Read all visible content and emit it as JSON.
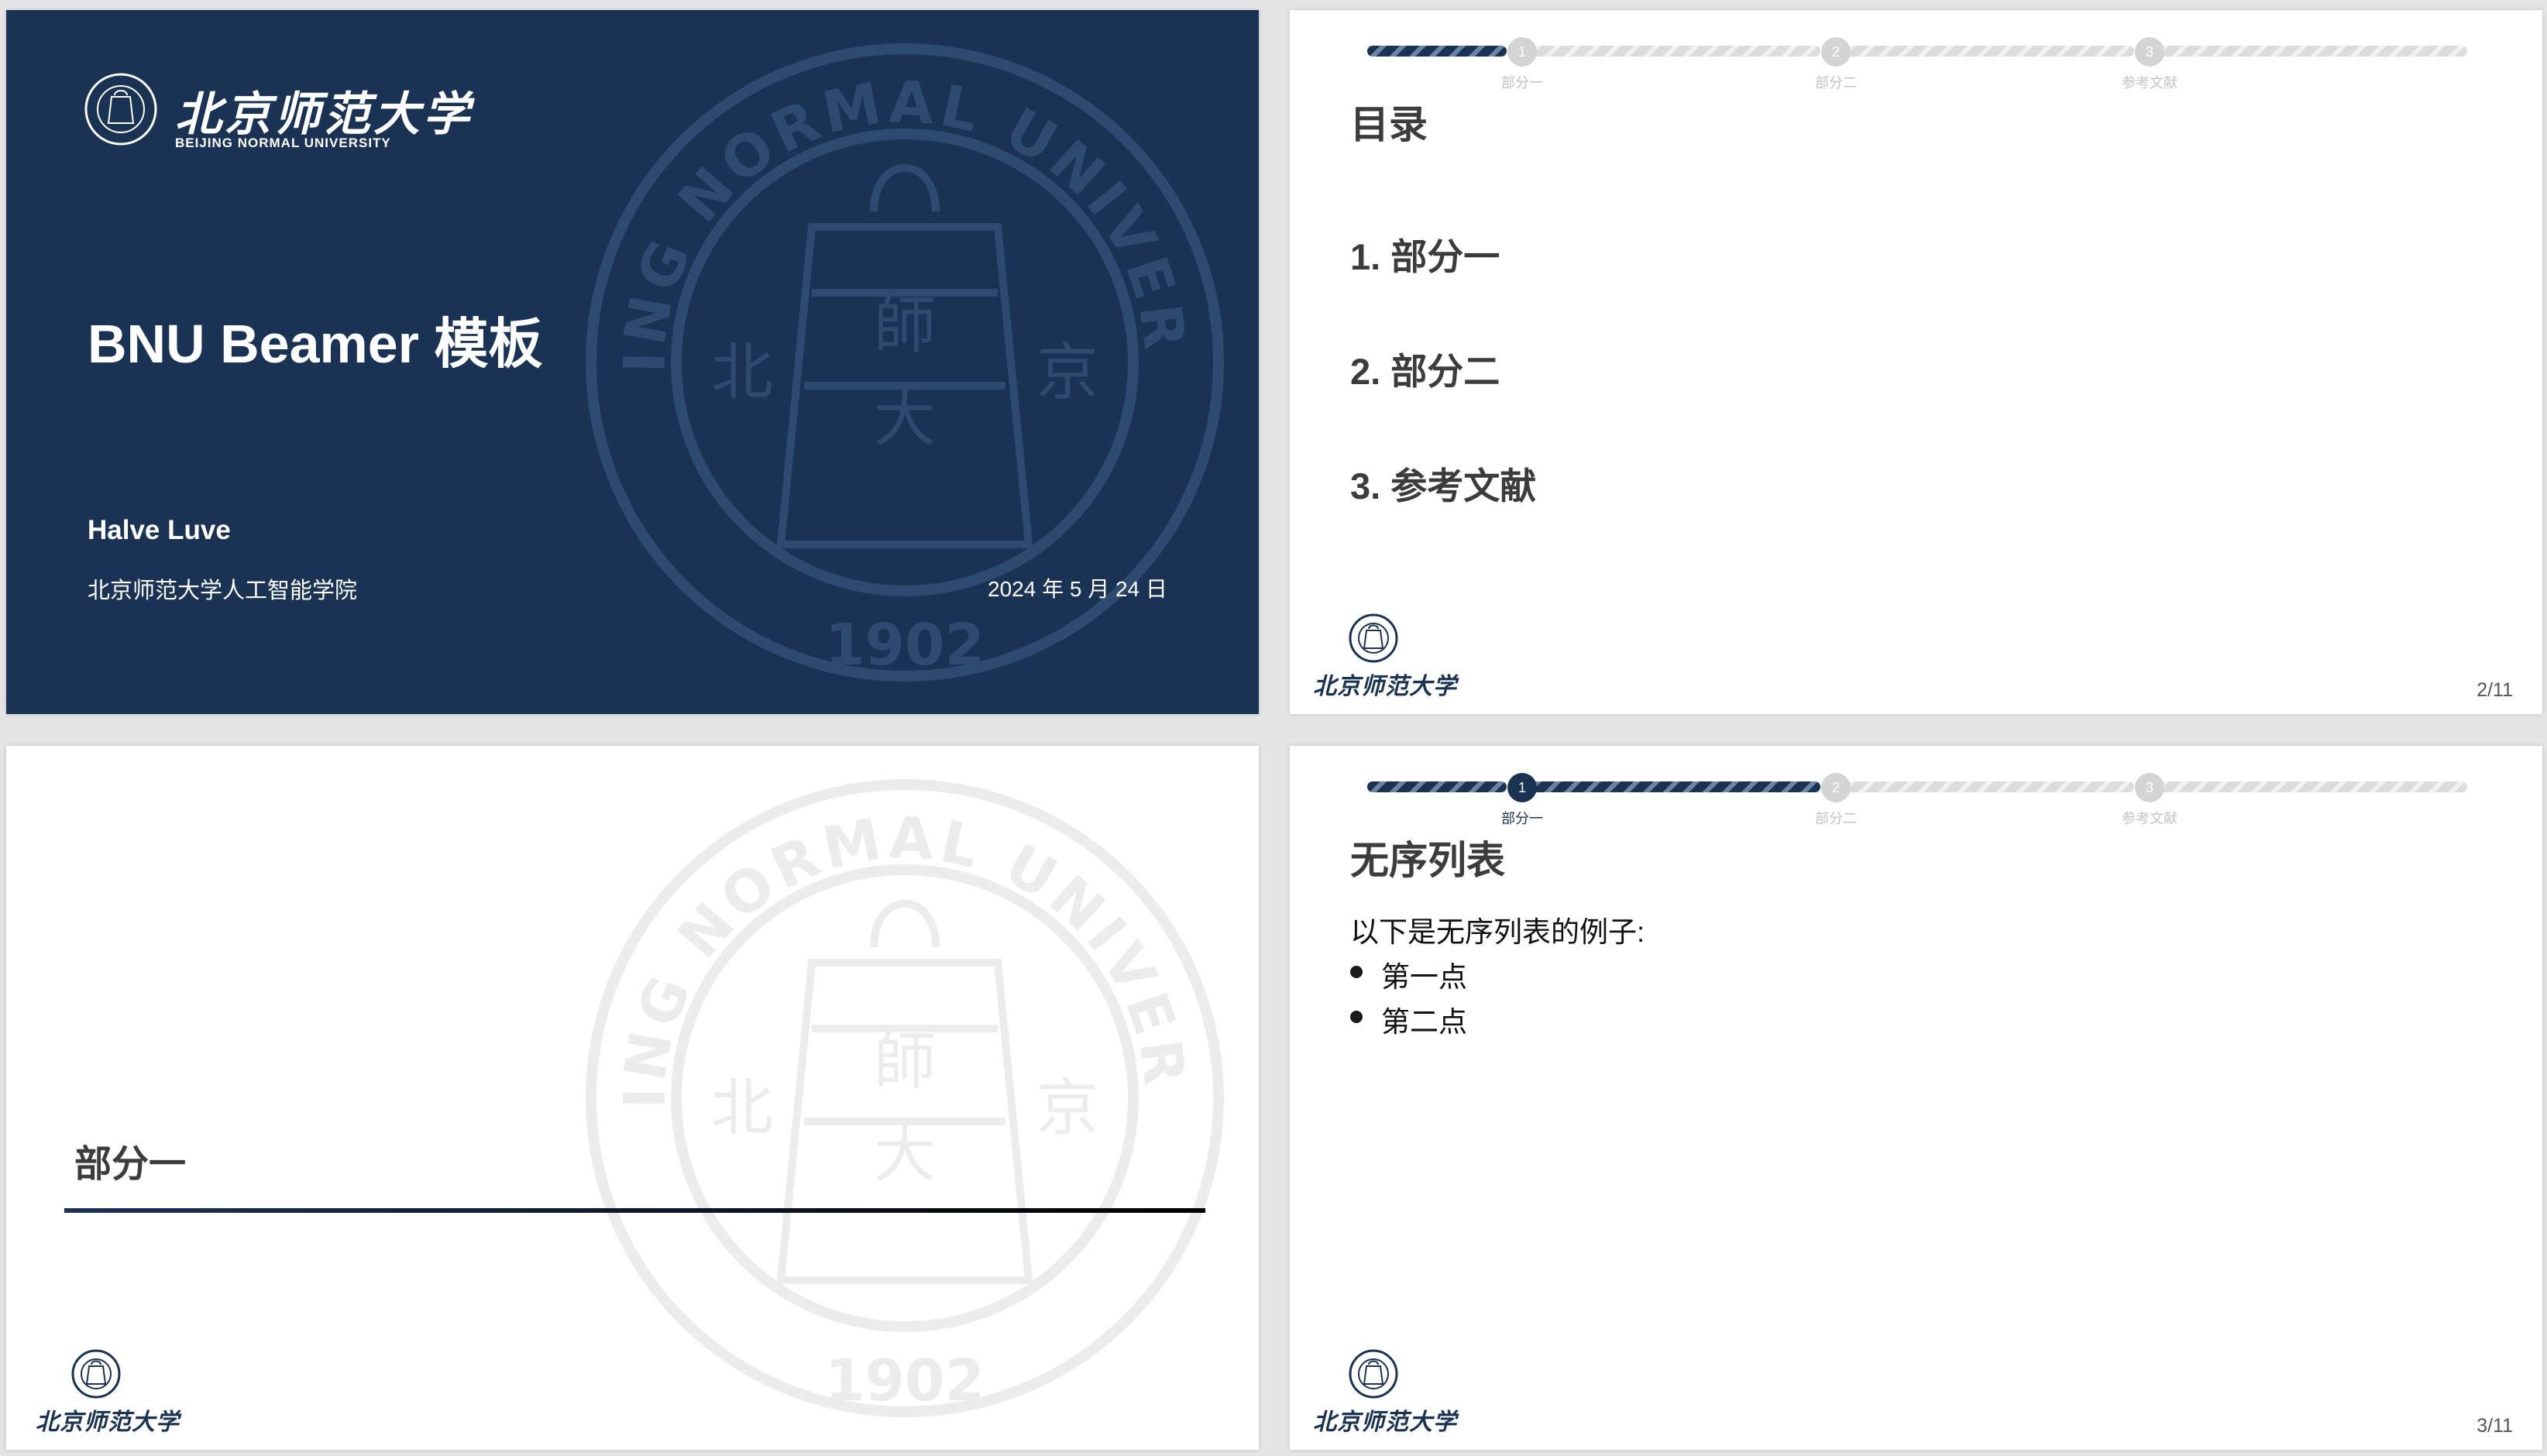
{
  "slide1": {
    "logo_cn": "北京师范大学",
    "logo_en": "BEIJING NORMAL UNIVERSITY",
    "title": "BNU Beamer 模板",
    "author": "Halve Luve",
    "institute": "北京师范大学人工智能学院",
    "date": "2024 年 5 月 24 日"
  },
  "watermark": {
    "ring_text": "BEIJING NORMAL UNIVERSITY",
    "year": "1902",
    "center_glyphs": [
      "北",
      "京",
      "師",
      "大"
    ]
  },
  "seal": {
    "year": "1902"
  },
  "progress": {
    "nodes": [
      {
        "number": "1",
        "label": "部分一"
      },
      {
        "number": "2",
        "label": "部分二"
      },
      {
        "number": "3",
        "label": "参考文献"
      }
    ]
  },
  "slide2": {
    "title": "目录",
    "toc": [
      "1. 部分一",
      "2. 部分二",
      "3. 参考文献"
    ],
    "footer_logo_text": "北京师范大学",
    "page": "2/11"
  },
  "slide3": {
    "section_title": "部分一",
    "footer_logo_text": "北京师范大学"
  },
  "slide4": {
    "title": "无序列表",
    "intro": "以下是无序列表的例子:",
    "items": [
      "第一点",
      "第二点"
    ],
    "footer_logo_text": "北京师范大学",
    "page": "3/11"
  },
  "colors": {
    "primary": "#1a3355",
    "text_dark": "#3c3c3c",
    "watermark_dark": "#2e4a70",
    "watermark_light": "#ececec",
    "inactive": "#d4d4d4"
  }
}
